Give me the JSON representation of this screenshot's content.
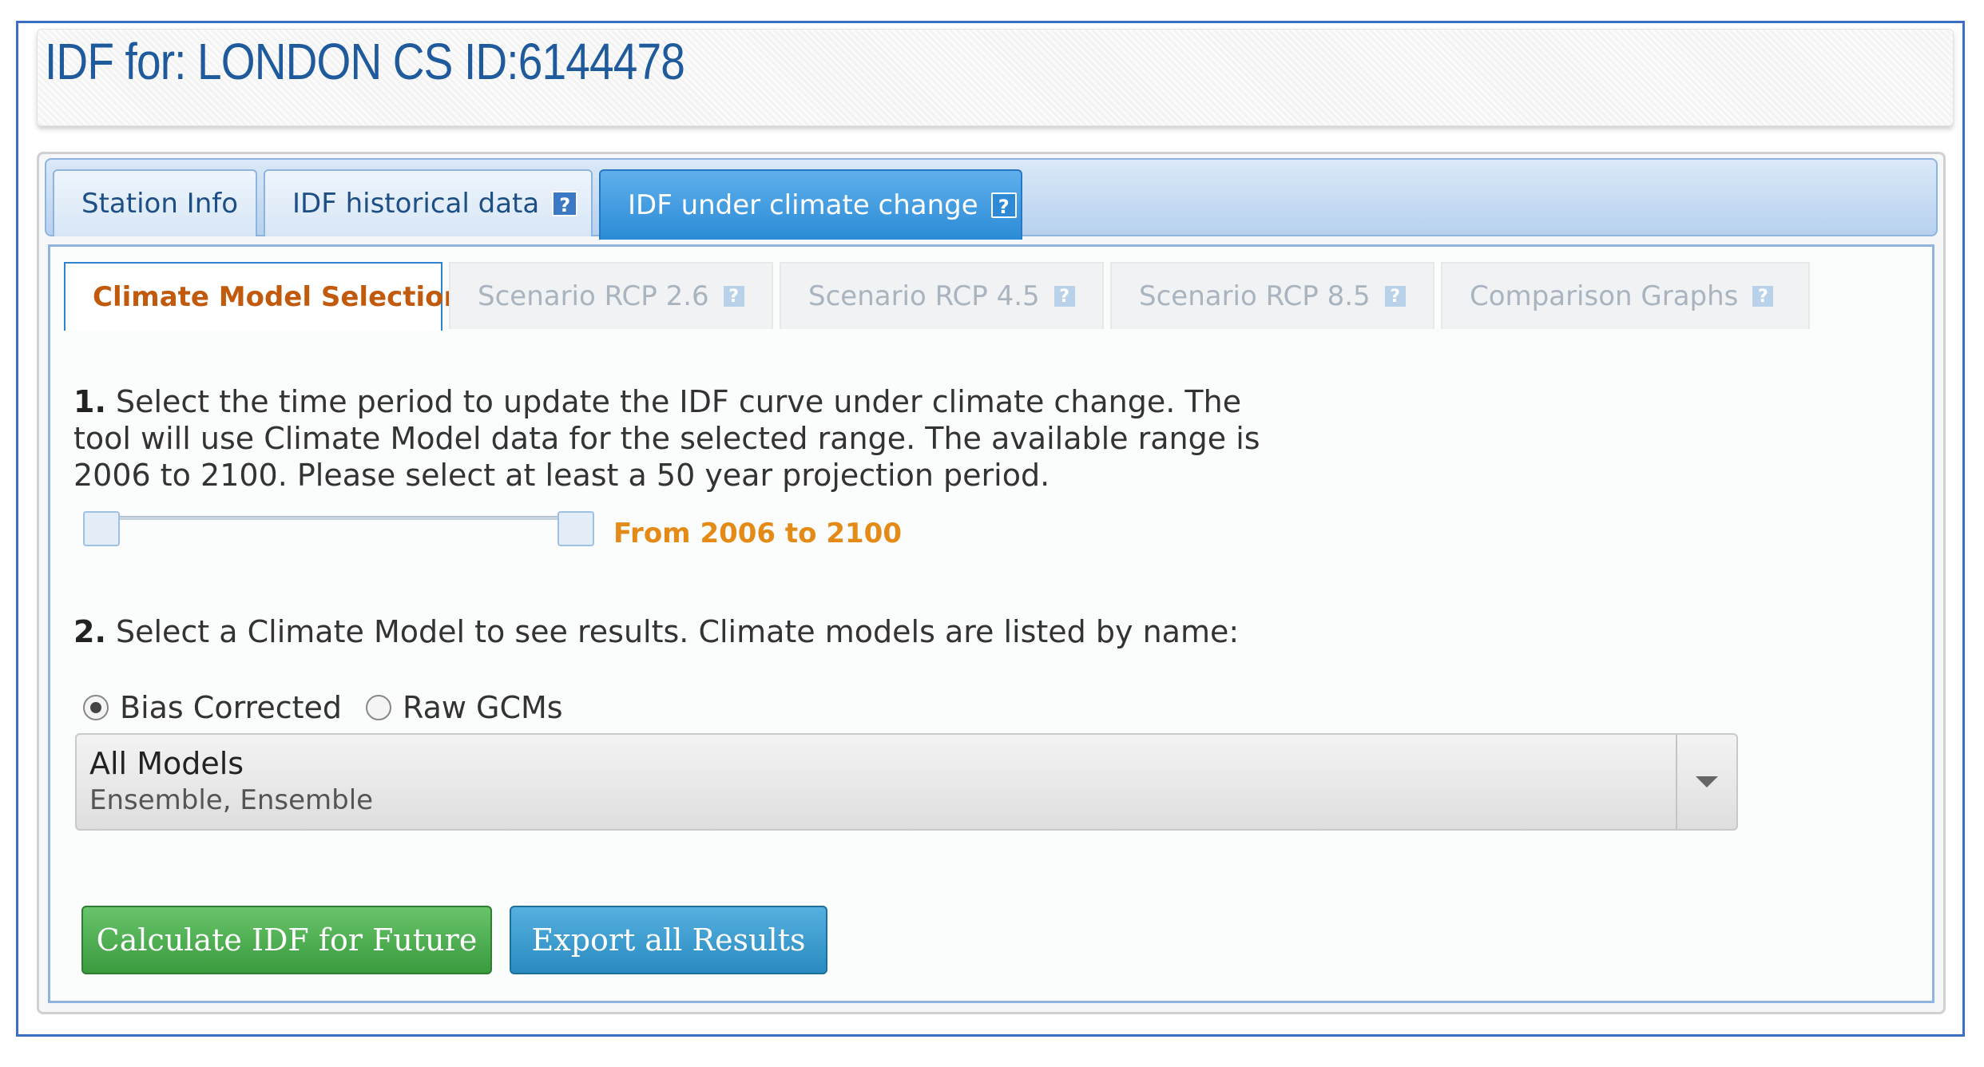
{
  "header": {
    "title": "IDF for: LONDON CS ID:6144478"
  },
  "top_tabs": [
    {
      "label": "Station Info",
      "help": false,
      "active": false
    },
    {
      "label": "IDF historical data",
      "help": true,
      "active": false
    },
    {
      "label": "IDF under climate change",
      "help": true,
      "active": true
    }
  ],
  "sub_tabs": [
    {
      "label": "Climate Model Selection",
      "active": true
    },
    {
      "label": "Scenario RCP 2.6",
      "active": false
    },
    {
      "label": "Scenario RCP 4.5",
      "active": false
    },
    {
      "label": "Scenario RCP 8.5",
      "active": false
    },
    {
      "label": "Comparison Graphs",
      "active": false
    }
  ],
  "help_glyph": "?",
  "step1": {
    "number": "1.",
    "line1": " Select the time period to update the IDF curve under climate change. The",
    "line2": "tool will use Climate Model data for the selected range. The available range is",
    "line3": "2006 to 2100. Please select at least a 50 year projection period."
  },
  "range": {
    "label": "From 2006 to 2100",
    "min": 2006,
    "max": 2100,
    "from": 2006,
    "to": 2100
  },
  "step2": {
    "number": "2.",
    "text": " Select a Climate Model to see results. Climate models are listed by name:"
  },
  "model_type": {
    "options": [
      {
        "label": "Bias Corrected",
        "checked": true
      },
      {
        "label": "Raw GCMs",
        "checked": false
      }
    ]
  },
  "model_select": {
    "main": "All Models",
    "sub": "Ensemble, Ensemble"
  },
  "buttons": {
    "calculate": "Calculate IDF for Future",
    "export": "Export all Results"
  },
  "colors": {
    "title": "#1e5a9c",
    "active_tab": "#2b8bd6",
    "active_subtab_text": "#c25a0d",
    "range_label": "#e48a17",
    "calculate_button": "#3a9a3e",
    "export_button": "#2a8bc1",
    "frame": "#3b6fc4"
  },
  "icons": {
    "help": "help-icon",
    "dropdown": "chevron-down-icon"
  }
}
